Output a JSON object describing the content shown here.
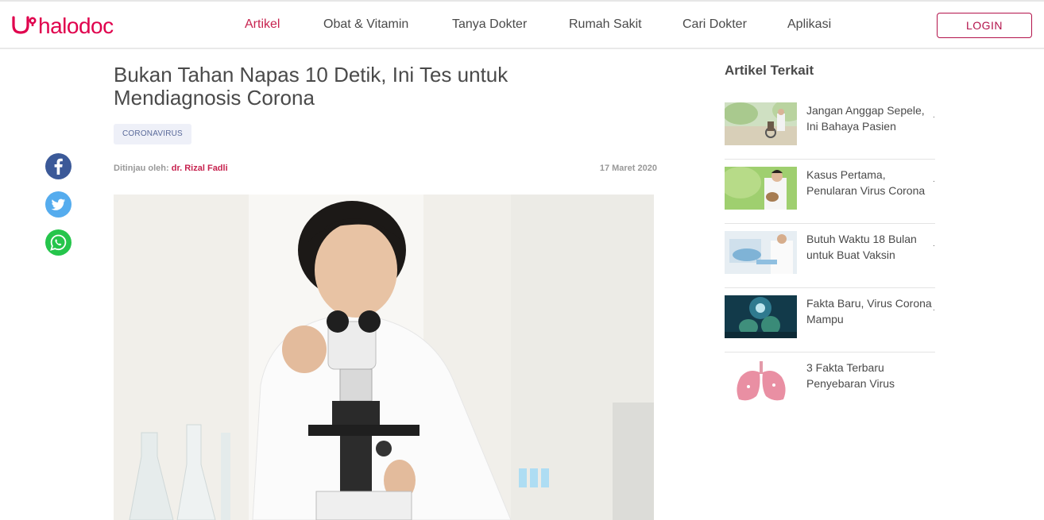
{
  "header": {
    "logo_text": "halodoc",
    "nav": [
      {
        "label": "Artikel",
        "active": true
      },
      {
        "label": "Obat & Vitamin",
        "active": false
      },
      {
        "label": "Tanya Dokter",
        "active": false
      },
      {
        "label": "Rumah Sakit",
        "active": false
      },
      {
        "label": "Cari Dokter",
        "active": false
      },
      {
        "label": "Aplikasi",
        "active": false
      }
    ],
    "login_label": "LOGIN"
  },
  "share": {
    "facebook_icon": "facebook-icon",
    "twitter_icon": "twitter-icon",
    "whatsapp_icon": "whatsapp-icon"
  },
  "article": {
    "title": "Bukan Tahan Napas 10 Detik, Ini Tes untuk Mendiagnosis Corona",
    "tag": "CORONAVIRUS",
    "reviewed_prefix": "Ditinjau oleh:",
    "reviewer": "dr. Rizal Fadli",
    "date": "17 Maret 2020"
  },
  "sidebar": {
    "title": "Artikel Terkait",
    "items": [
      {
        "title": "Jangan Anggap Sepele, Ini Bahaya Pasien"
      },
      {
        "title": "Kasus Pertama, Penularan Virus Corona"
      },
      {
        "title": "Butuh Waktu 18 Bulan untuk Buat Vaksin"
      },
      {
        "title": "Fakta Baru, Virus Corona Mampu"
      },
      {
        "title": "3 Fakta Terbaru Penyebaran Virus"
      }
    ]
  },
  "colors": {
    "brand": "#e0004d",
    "nav_active": "#c7234f",
    "facebook": "#3b5998",
    "twitter": "#55acee",
    "whatsapp": "#25c54b"
  }
}
